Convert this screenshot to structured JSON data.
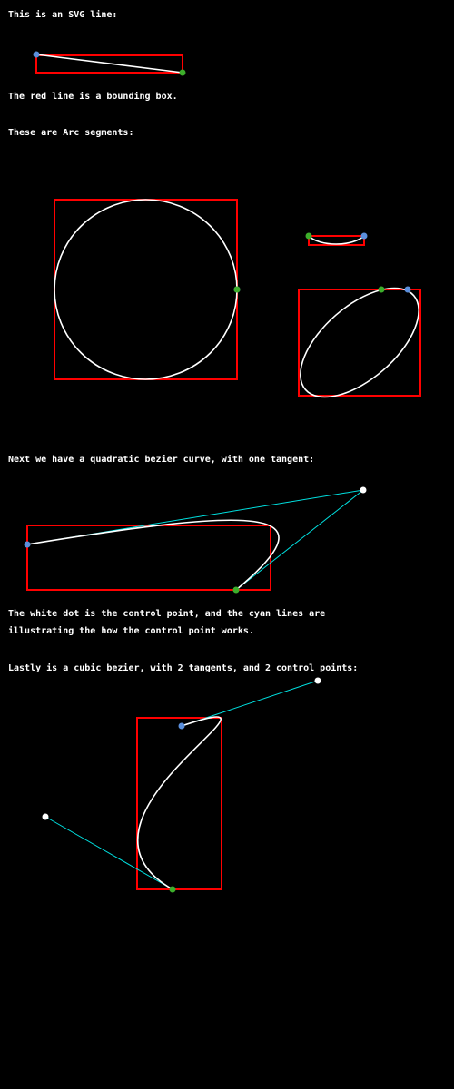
{
  "colors": {
    "background": "#000000",
    "text": "#ffffff",
    "curve": "#ffffff",
    "bbox": "#ff0000",
    "tangent": "#00e0e0",
    "start_point": "#5b8fdc",
    "end_point": "#3dae2b",
    "control_point": "#ffffff"
  },
  "captions": {
    "line_intro": "This is an SVG line:",
    "bbox_note": "The red line is a bounding box.",
    "arc_intro": "These are Arc segments:",
    "quad_intro": "Next we have a quadratic bezier curve, with one tangent:",
    "control_note_1": "The white dot is the control point, and the cyan lines are",
    "control_note_2": "illustrating the how the control point works.",
    "cubic_intro": "Lastly is a cubic bezier, with 2 tangents, and 2 control points:"
  }
}
